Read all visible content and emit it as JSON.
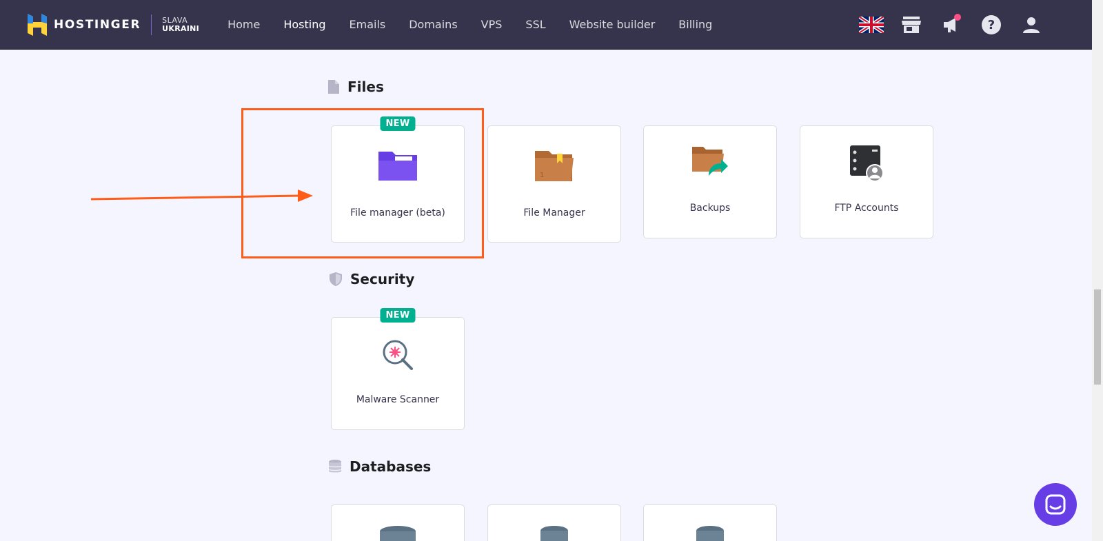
{
  "header": {
    "brand_name": "HOSTINGER",
    "brand_sub_line1": "SLAVA",
    "brand_sub_line2": "UKRAINI",
    "nav": [
      {
        "label": "Home",
        "active": false
      },
      {
        "label": "Hosting",
        "active": true
      },
      {
        "label": "Emails",
        "active": false
      },
      {
        "label": "Domains",
        "active": false
      },
      {
        "label": "VPS",
        "active": false
      },
      {
        "label": "SSL",
        "active": false
      },
      {
        "label": "Website builder",
        "active": false
      },
      {
        "label": "Billing",
        "active": false
      }
    ],
    "icons": [
      "uk-flag-icon",
      "store-icon",
      "megaphone-icon",
      "help-icon",
      "user-icon"
    ]
  },
  "sections": {
    "files": {
      "title": "Files",
      "icon": "file-icon",
      "cards": [
        {
          "label": "File manager (beta)",
          "badge": "NEW",
          "icon": "purple-folder-icon",
          "highlighted": true
        },
        {
          "label": "File Manager",
          "badge": "",
          "icon": "brown-folder-icon"
        },
        {
          "label": "Backups",
          "badge": "",
          "icon": "backup-folder-icon"
        },
        {
          "label": "FTP Accounts",
          "badge": "",
          "icon": "ftp-server-icon"
        }
      ]
    },
    "security": {
      "title": "Security",
      "icon": "shield-icon",
      "cards": [
        {
          "label": "Malware Scanner",
          "badge": "NEW",
          "icon": "magnifier-bug-icon"
        }
      ]
    },
    "databases": {
      "title": "Databases",
      "icon": "database-icon",
      "cards": [
        {
          "icon": "database-icon"
        },
        {
          "icon": "database-icon"
        },
        {
          "icon": "database-icon"
        }
      ]
    }
  },
  "colors": {
    "header_bg": "#36344d",
    "page_bg": "#f4f5ff",
    "badge_green": "#00b090",
    "highlight_orange": "#ff5c1a",
    "accent_purple": "#673de6"
  }
}
